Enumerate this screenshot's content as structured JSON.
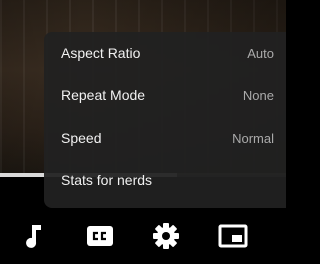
{
  "player": {
    "progress_fraction": 0.62
  },
  "settings_menu": {
    "items": [
      {
        "label": "Aspect Ratio",
        "value": "Auto"
      },
      {
        "label": "Repeat Mode",
        "value": "None"
      },
      {
        "label": "Speed",
        "value": "Normal"
      },
      {
        "label": "Stats for nerds",
        "value": ""
      }
    ]
  },
  "controls": {
    "buttons": [
      {
        "name": "music-note-icon"
      },
      {
        "name": "closed-captions-icon"
      },
      {
        "name": "settings-gear-icon"
      },
      {
        "name": "picture-in-picture-icon"
      }
    ],
    "icon_color": "#ffffff"
  }
}
